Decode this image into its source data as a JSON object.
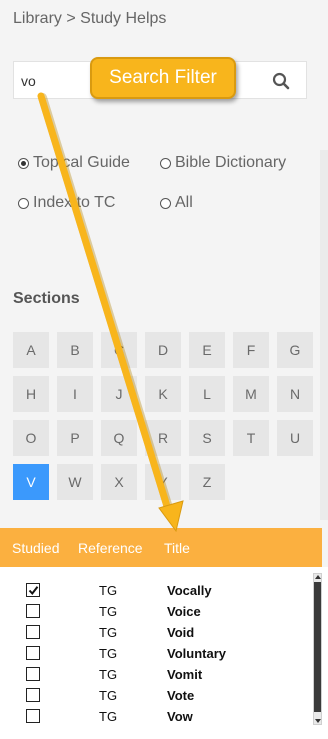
{
  "breadcrumb": "Library > Study Helps",
  "search": {
    "value": "vo",
    "placeholder": ""
  },
  "callout": "Search Filter",
  "filters": [
    {
      "label": "Topical Guide",
      "selected": true
    },
    {
      "label": "Bible Dictionary",
      "selected": false
    },
    {
      "label": "Index to TC",
      "selected": false
    },
    {
      "label": "All",
      "selected": false
    }
  ],
  "sections": {
    "heading": "Sections",
    "letters": [
      "A",
      "B",
      "C",
      "D",
      "E",
      "F",
      "G",
      "H",
      "I",
      "J",
      "K",
      "L",
      "M",
      "N",
      "O",
      "P",
      "Q",
      "R",
      "S",
      "T",
      "U",
      "V",
      "W",
      "X",
      "Y",
      "Z"
    ],
    "active": "V"
  },
  "table": {
    "headers": [
      "Studied",
      "Reference",
      "Title"
    ],
    "rows": [
      {
        "checked": true,
        "ref": "TG",
        "title": "Vocally"
      },
      {
        "checked": false,
        "ref": "TG",
        "title": "Voice"
      },
      {
        "checked": false,
        "ref": "TG",
        "title": "Void"
      },
      {
        "checked": false,
        "ref": "TG",
        "title": "Voluntary"
      },
      {
        "checked": false,
        "ref": "TG",
        "title": "Vomit"
      },
      {
        "checked": false,
        "ref": "TG",
        "title": "Vote"
      },
      {
        "checked": false,
        "ref": "TG",
        "title": "Vow"
      }
    ]
  },
  "colors": {
    "accent": "#fbb040",
    "callout": "#f8b51c",
    "active_letter": "#3b99fc"
  }
}
